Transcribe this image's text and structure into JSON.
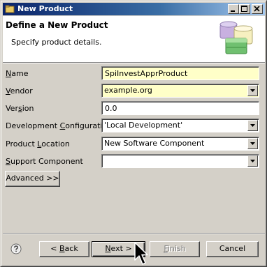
{
  "window": {
    "title": "New Product",
    "title_icon": "folder-window-icon",
    "controls": [
      "minimize-icon",
      "maximize-icon",
      "close-icon"
    ]
  },
  "banner": {
    "heading": "Define a New Product",
    "description": "Specify product details.",
    "logo": "database-stack-icon"
  },
  "form": {
    "name": {
      "label_pre": "",
      "label_u": "N",
      "label_post": "ame",
      "value": "SpiInvestApprProduct"
    },
    "vendor": {
      "label_pre": "",
      "label_u": "V",
      "label_post": "endor",
      "value": "example.org"
    },
    "version": {
      "label_pre": "Ver",
      "label_u": "s",
      "label_post": "ion",
      "value": "0.0"
    },
    "dev_config": {
      "label_pre": "Development ",
      "label_u": "C",
      "label_post": "onfiguration",
      "value": "'Local Development'"
    },
    "location": {
      "label_pre": "Product ",
      "label_u": "L",
      "label_post": "ocation",
      "value": "New Software Component"
    },
    "support": {
      "label_pre": "",
      "label_u": "S",
      "label_post": "upport Component",
      "value": ""
    },
    "advanced_label": "Advanced >>"
  },
  "buttons": {
    "back": {
      "pre": "< ",
      "u": "B",
      "post": "ack"
    },
    "next": {
      "pre": "",
      "u": "N",
      "post": "ext >"
    },
    "finish": {
      "pre": "",
      "u": "F",
      "post": "inish"
    },
    "cancel": "Cancel"
  },
  "colors": {
    "required_field_bg": "#ffffc8",
    "window_bg": "#d4d0c8",
    "titlebar_start": "#0a246a"
  }
}
